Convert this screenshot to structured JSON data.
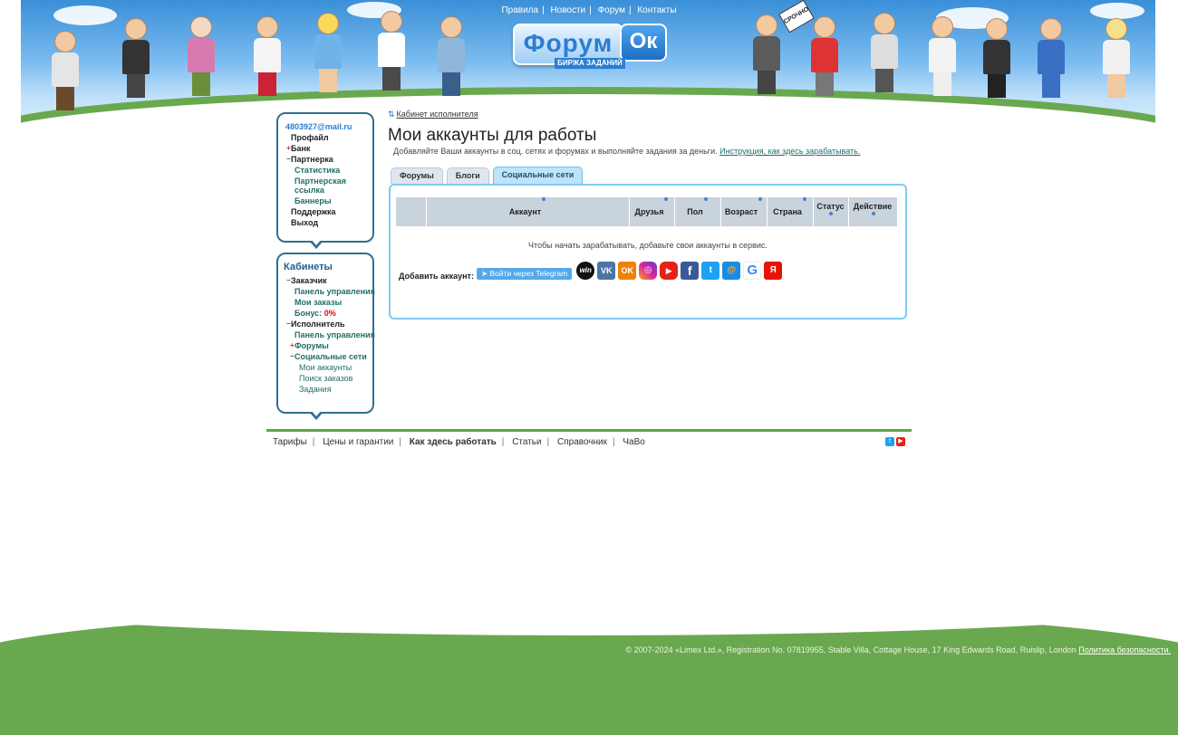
{
  "top_nav": {
    "items": [
      {
        "label": "Правила"
      },
      {
        "label": "Новости"
      },
      {
        "label": "Форум"
      },
      {
        "label": "Контакты"
      }
    ],
    "separator": "|"
  },
  "logo": {
    "word": "Форум",
    "ok": "Ок",
    "subtitle": "БИРЖА ЗАДАНИЙ"
  },
  "header_sign": "СРОЧНО",
  "sidebar": {
    "email": "4803927@mail.ru",
    "menu": {
      "profile": "Профайл",
      "bank": "Банк",
      "partner": "Партнерка",
      "stats": "Статистика",
      "partner_link": "Партнерская ссылка",
      "banners": "Баннеры",
      "support": "Поддержка",
      "logout": "Выход"
    },
    "cabinets": {
      "title": "Кабинеты",
      "customer": "Заказчик",
      "customer_panel": "Панель управления",
      "my_orders": "Мои заказы",
      "bonus_label": "Бонус:",
      "bonus_value": "0%",
      "executor": "Исполнитель",
      "executor_panel": "Панель управления",
      "forums": "Форумы",
      "social": "Социальные сети",
      "my_accounts": "Мои аккаунты",
      "order_search": "Поиск заказов",
      "tasks": "Задания"
    }
  },
  "main": {
    "breadcrumb": "Кабинет исполнителя",
    "title": "Мои аккаунты для работы",
    "description": "Добавляйте Ваши аккаунты в соц. сетях и форумах и выполняйте задания за деньги.",
    "instruction_link": "Инструкция, как здесь зарабатывать.",
    "tabs": [
      {
        "label": "Форумы",
        "active": false
      },
      {
        "label": "Блоги",
        "active": false
      },
      {
        "label": "Социальные сети",
        "active": true
      }
    ],
    "table": {
      "columns": [
        "Аккаунт",
        "Друзья",
        "Пол",
        "Возраст",
        "Страна",
        "Статус",
        "Действие"
      ]
    },
    "empty_message": "Чтобы начать зарабатывать, добавьте свои аккаунты в сервис.",
    "add_account_label": "Добавить аккаунт:",
    "telegram_button": "Войти через Telegram",
    "social_networks": [
      {
        "name": "win-icon",
        "glyph": "win",
        "color": "#111111"
      },
      {
        "name": "vk-icon",
        "glyph": "VK",
        "color": "#4c75a3"
      },
      {
        "name": "odnoklassniki-icon",
        "glyph": "OK",
        "color": "#ee8208"
      },
      {
        "name": "instagram-icon",
        "glyph": "◎",
        "color": "#c13584"
      },
      {
        "name": "youtube-icon",
        "glyph": "▶",
        "color": "#e62117"
      },
      {
        "name": "facebook-icon",
        "glyph": "f",
        "color": "#3b5998"
      },
      {
        "name": "twitter-icon",
        "glyph": "t",
        "color": "#1da1f2"
      },
      {
        "name": "mailru-icon",
        "glyph": "@",
        "color": "#168de2"
      },
      {
        "name": "google-icon",
        "glyph": "G",
        "color": "#ffffff"
      },
      {
        "name": "yandex-icon",
        "glyph": "Я",
        "color": "#e61400"
      }
    ]
  },
  "footer": {
    "links": [
      {
        "label": "Тарифы",
        "bold": false
      },
      {
        "label": "Цены и гарантии",
        "bold": false
      },
      {
        "label": "Как здесь работать",
        "bold": true
      },
      {
        "label": "Статьи",
        "bold": false
      },
      {
        "label": "Справочник",
        "bold": false
      },
      {
        "label": "ЧаВо",
        "bold": false
      }
    ],
    "copyright": "© 2007-2024 «Limex Ltd.», Registration No. 07819955, Stable Villa, Cottage House, 17 King Edwards Road, Ruislip, London",
    "privacy_link": "Политика безопасности."
  }
}
